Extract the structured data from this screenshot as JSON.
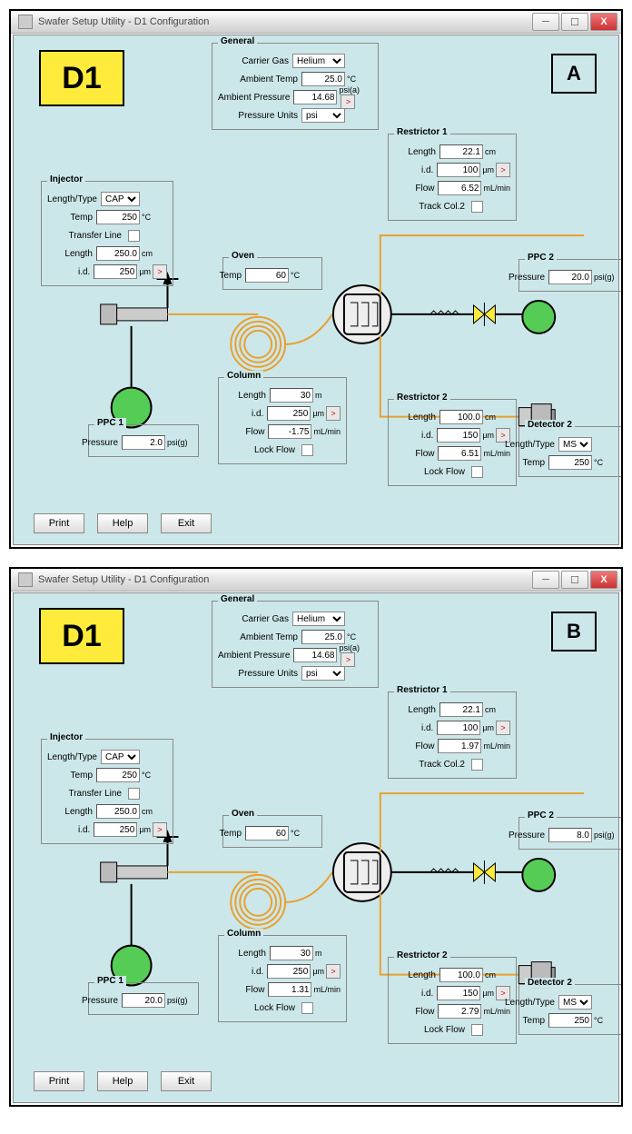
{
  "windows": [
    {
      "title": "Swafer Setup Utility - D1 Configuration",
      "badge": "D1",
      "letter": "A",
      "general": {
        "title": "General",
        "carrier_gas_label": "Carrier Gas",
        "carrier_gas": "Helium",
        "ambient_temp_label": "Ambient Temp",
        "ambient_temp": "25.0",
        "ambient_temp_unit": "°C",
        "ambient_pressure_label": "Ambient Pressure",
        "ambient_pressure": "14.68",
        "ambient_pressure_unit": "psi(a)",
        "pressure_units_label": "Pressure Units",
        "pressure_units": "psi"
      },
      "injector": {
        "title": "Injector",
        "length_type_label": "Length/Type",
        "length_type": "CAP",
        "temp_label": "Temp",
        "temp": "250",
        "temp_unit": "°C",
        "transfer_line_label": "Transfer Line",
        "length_label": "Length",
        "length": "250.0",
        "length_unit": "cm",
        "id_label": "i.d.",
        "id": "250",
        "id_unit": "µm"
      },
      "oven": {
        "title": "Oven",
        "temp_label": "Temp",
        "temp": "60",
        "temp_unit": "°C"
      },
      "column": {
        "title": "Column",
        "length_label": "Length",
        "length": "30",
        "length_unit": "m",
        "id_label": "i.d.",
        "id": "250",
        "id_unit": "µm",
        "flow_label": "Flow",
        "flow": "-1.75",
        "flow_unit": "mL/min",
        "lock_flow_label": "Lock Flow"
      },
      "restrictor1": {
        "title": "Restrictor 1",
        "length_label": "Length",
        "length": "22.1",
        "length_unit": "cm",
        "id_label": "i.d.",
        "id": "100",
        "id_unit": "µm",
        "flow_label": "Flow",
        "flow": "6.52",
        "flow_unit": "mL/min",
        "track_label": "Track Col.2"
      },
      "restrictor2": {
        "title": "Restrictor 2",
        "length_label": "Length",
        "length": "100.0",
        "length_unit": "cm",
        "id_label": "i.d.",
        "id": "150",
        "id_unit": "µm",
        "flow_label": "Flow",
        "flow": "6.51",
        "flow_unit": "mL/min",
        "lock_flow_label": "Lock Flow"
      },
      "ppc1": {
        "title": "PPC 1",
        "pressure_label": "Pressure",
        "pressure": "2.0",
        "pressure_unit": "psi(g)"
      },
      "ppc2": {
        "title": "PPC 2",
        "pressure_label": "Pressure",
        "pressure": "20.0",
        "pressure_unit": "psi(g)"
      },
      "detector2": {
        "title": "Detector 2",
        "length_type_label": "Length/Type",
        "length_type": "MS",
        "temp_label": "Temp",
        "temp": "250",
        "temp_unit": "°C"
      },
      "buttons": {
        "print": "Print",
        "help": "Help",
        "exit": "Exit"
      }
    },
    {
      "title": "Swafer Setup Utility - D1 Configuration",
      "badge": "D1",
      "letter": "B",
      "general": {
        "title": "General",
        "carrier_gas_label": "Carrier Gas",
        "carrier_gas": "Helium",
        "ambient_temp_label": "Ambient Temp",
        "ambient_temp": "25.0",
        "ambient_temp_unit": "°C",
        "ambient_pressure_label": "Ambient Pressure",
        "ambient_pressure": "14.68",
        "ambient_pressure_unit": "psi(a)",
        "pressure_units_label": "Pressure Units",
        "pressure_units": "psi"
      },
      "injector": {
        "title": "Injector",
        "length_type_label": "Length/Type",
        "length_type": "CAP",
        "temp_label": "Temp",
        "temp": "250",
        "temp_unit": "°C",
        "transfer_line_label": "Transfer Line",
        "length_label": "Length",
        "length": "250.0",
        "length_unit": "cm",
        "id_label": "i.d.",
        "id": "250",
        "id_unit": "µm"
      },
      "oven": {
        "title": "Oven",
        "temp_label": "Temp",
        "temp": "60",
        "temp_unit": "°C"
      },
      "column": {
        "title": "Column",
        "length_label": "Length",
        "length": "30",
        "length_unit": "m",
        "id_label": "i.d.",
        "id": "250",
        "id_unit": "µm",
        "flow_label": "Flow",
        "flow": "1.31",
        "flow_unit": "mL/min",
        "lock_flow_label": "Lock Flow"
      },
      "restrictor1": {
        "title": "Restrictor 1",
        "length_label": "Length",
        "length": "22.1",
        "length_unit": "cm",
        "id_label": "i.d.",
        "id": "100",
        "id_unit": "µm",
        "flow_label": "Flow",
        "flow": "1.97",
        "flow_unit": "mL/min",
        "track_label": "Track Col.2"
      },
      "restrictor2": {
        "title": "Restrictor 2",
        "length_label": "Length",
        "length": "100.0",
        "length_unit": "cm",
        "id_label": "i.d.",
        "id": "150",
        "id_unit": "µm",
        "flow_label": "Flow",
        "flow": "2.79",
        "flow_unit": "mL/min",
        "lock_flow_label": "Lock Flow"
      },
      "ppc1": {
        "title": "PPC 1",
        "pressure_label": "Pressure",
        "pressure": "20.0",
        "pressure_unit": "psi(g)"
      },
      "ppc2": {
        "title": "PPC 2",
        "pressure_label": "Pressure",
        "pressure": "8.0",
        "pressure_unit": "psi(g)"
      },
      "detector2": {
        "title": "Detector 2",
        "length_type_label": "Length/Type",
        "length_type": "MS",
        "temp_label": "Temp",
        "temp": "250",
        "temp_unit": "°C"
      },
      "buttons": {
        "print": "Print",
        "help": "Help",
        "exit": "Exit"
      }
    }
  ]
}
